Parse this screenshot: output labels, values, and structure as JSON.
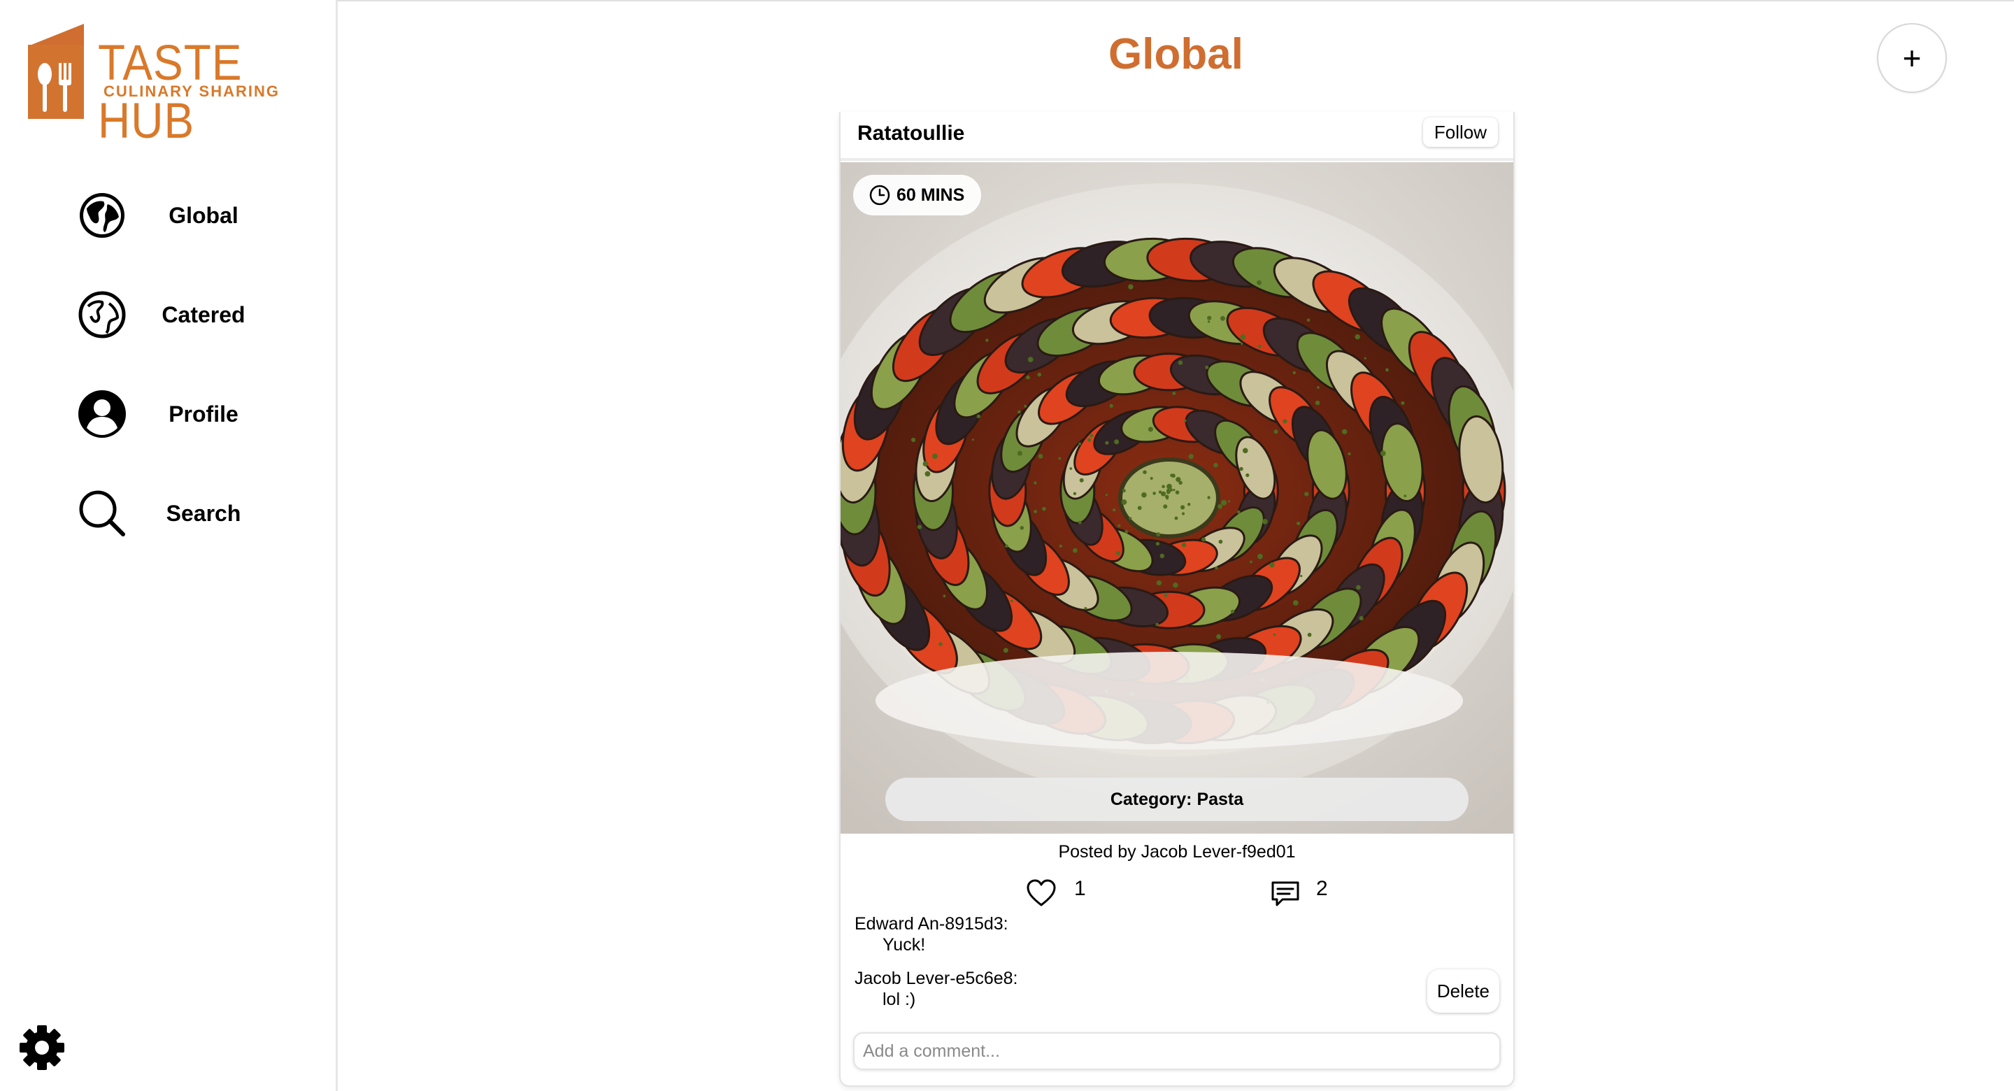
{
  "brand": {
    "name": "TASTE HUB",
    "tagline": "CULINARY SHARING",
    "color": "#d9792a"
  },
  "sidebar": {
    "items": [
      {
        "label": "Global",
        "icon": "globe-filled-icon"
      },
      {
        "label": "Catered",
        "icon": "globe-outline-icon"
      },
      {
        "label": "Profile",
        "icon": "user-circle-icon"
      },
      {
        "label": "Search",
        "icon": "search-icon"
      }
    ],
    "settings_icon": "gear-icon"
  },
  "header": {
    "title": "Global",
    "title_color": "#cf6e30",
    "add_label": "+"
  },
  "post": {
    "title": "Ratatoullie",
    "follow_label": "Follow",
    "time": "60 MINS",
    "category": "Category: Pasta",
    "posted_by": "Posted by Jacob Lever-f9ed01",
    "likes": "1",
    "comments_count": "2",
    "comments": [
      {
        "author": "Edward An-8915d3:",
        "text": "Yuck!"
      },
      {
        "author": "Jacob Lever-e5c6e8:",
        "text": "lol :)"
      }
    ],
    "delete_label": "Delete",
    "comment_placeholder": "Add a comment..."
  }
}
